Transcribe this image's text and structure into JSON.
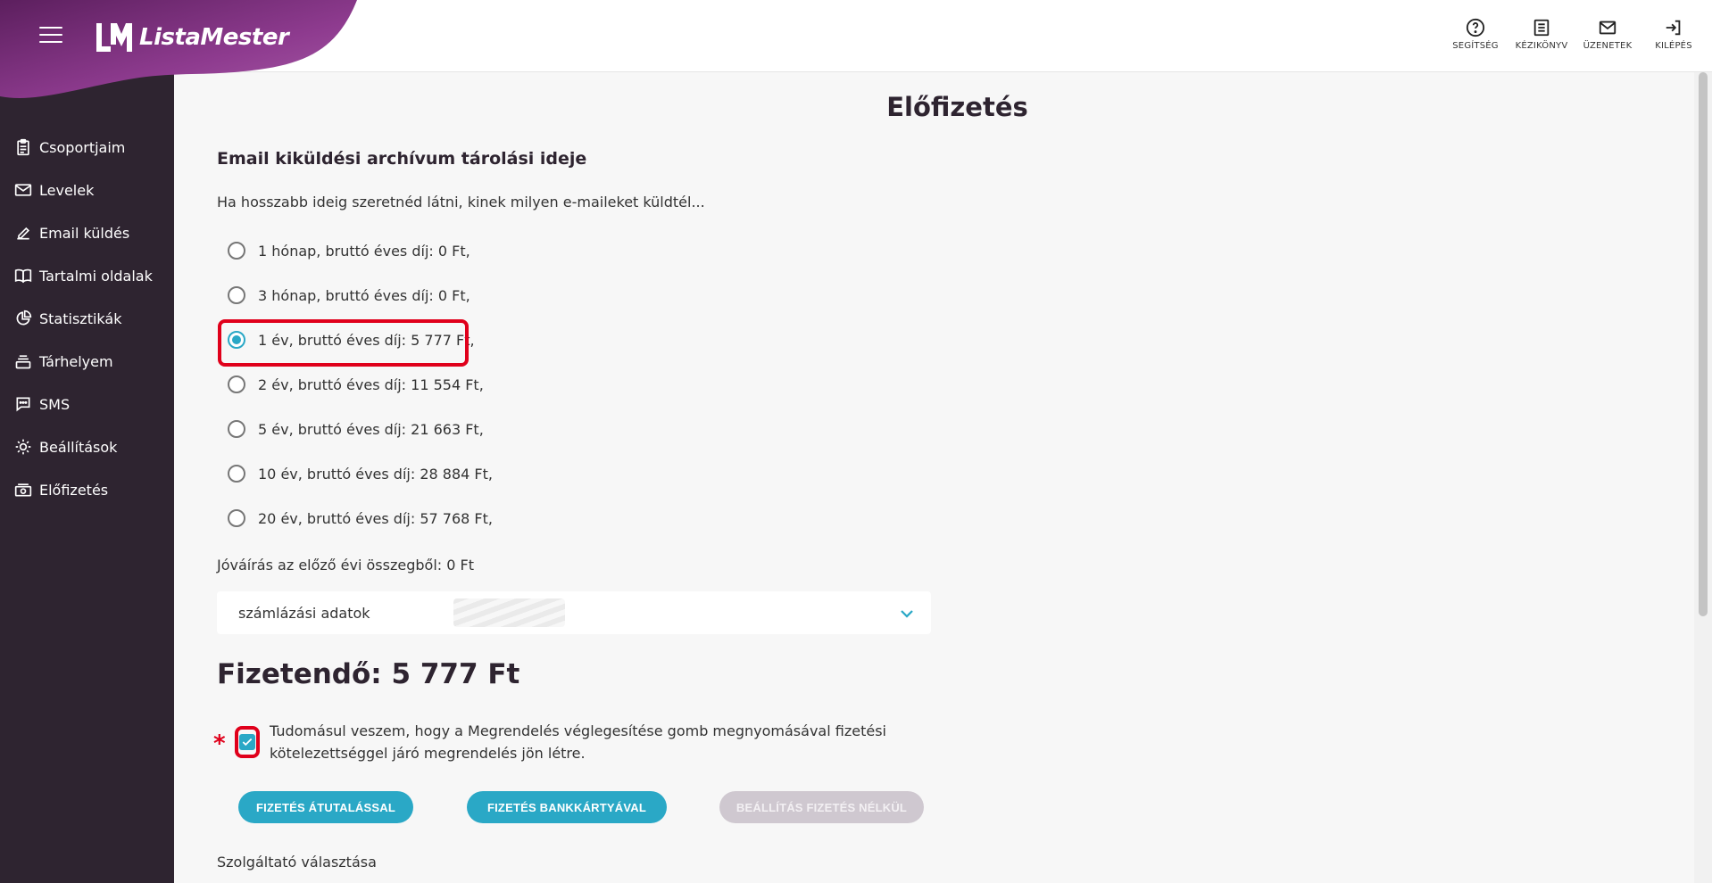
{
  "app": {
    "logo_text": "ListaMester",
    "brand_color": "#8e3b8f",
    "accent_color": "#2aa8c6",
    "highlight_color": "#e0001b"
  },
  "top_actions": [
    {
      "label": "SEGÍTSÉG",
      "icon": "help-icon"
    },
    {
      "label": "KÉZIKÖNYV",
      "icon": "manual-icon"
    },
    {
      "label": "ÜZENETEK",
      "icon": "mail-icon"
    },
    {
      "label": "KILÉPÉS",
      "icon": "logout-icon"
    }
  ],
  "sidebar": {
    "items": [
      {
        "label": "Csoportjaim",
        "icon": "clipboard-icon"
      },
      {
        "label": "Levelek",
        "icon": "envelope-icon"
      },
      {
        "label": "Email küldés",
        "icon": "pencil-icon"
      },
      {
        "label": "Tartalmi oldalak",
        "icon": "book-icon"
      },
      {
        "label": "Statisztikák",
        "icon": "pie-chart-icon"
      },
      {
        "label": "Tárhelyem",
        "icon": "storage-icon"
      },
      {
        "label": "SMS",
        "icon": "chat-icon"
      },
      {
        "label": "Beállítások",
        "icon": "gear-icon"
      },
      {
        "label": "Előfizetés",
        "icon": "money-icon"
      }
    ]
  },
  "main": {
    "page_title": "Előfizetés",
    "section_title": "Email kiküldési archívum tárolási ideje",
    "subtitle": "Ha hosszabb ideig szeretnéd látni, kinek milyen e-maileket küldtél...",
    "options": [
      {
        "label": "1 hónap, bruttó éves díj: 0 Ft,",
        "checked": false
      },
      {
        "label": "3 hónap, bruttó éves díj: 0 Ft,",
        "checked": false
      },
      {
        "label": "1 év, bruttó éves díj: 5 777 Ft,",
        "checked": true
      },
      {
        "label": "2 év, bruttó éves díj: 11 554 Ft,",
        "checked": false
      },
      {
        "label": "5 év, bruttó éves díj: 21 663 Ft,",
        "checked": false
      },
      {
        "label": "10 év, bruttó éves díj: 28 884 Ft,",
        "checked": false
      },
      {
        "label": "20 év, bruttó éves díj: 57 768 Ft,",
        "checked": false
      }
    ],
    "credit": "Jóváírás az előző évi összegből: 0 Ft",
    "billing_dropdown": "számlázási adatok",
    "payable": "Fizetendő: 5 777 Ft",
    "required_mark": "*",
    "consent_text": "Tudomásul veszem, hogy a Megrendelés véglegesítése gomb megnyomásával fizetési kötelezettséggel járó megrendelés jön létre.",
    "consent_checked": true,
    "buttons": {
      "transfer": "FIZETÉS ÁTUTALÁSSAL",
      "card": "FIZETÉS BANKKÁRTYÁVAL",
      "no_payment": "BEÁLLÍTÁS FIZETÉS NÉLKÜL"
    },
    "provider_label": "Szolgáltató választása"
  }
}
